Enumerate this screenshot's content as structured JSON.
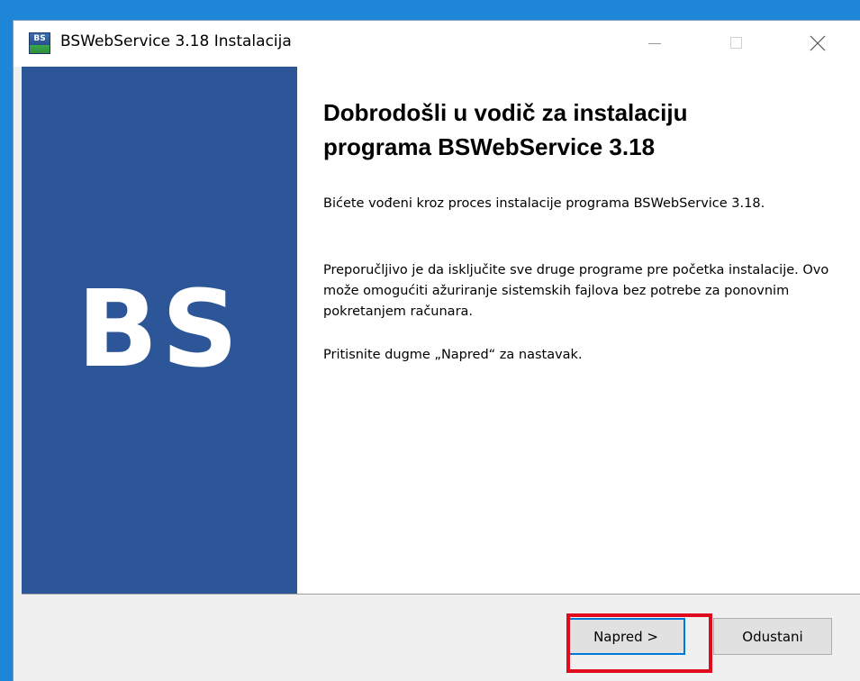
{
  "window": {
    "title": "BSWebService 3.18 Instalacija",
    "icon": "bs-app-icon",
    "icon_text": "BS"
  },
  "titlebar_controls": [
    "minimize",
    "maximize",
    "close"
  ],
  "sidebar": {
    "logo_text": "BS",
    "background": "#2d5699"
  },
  "main": {
    "heading": "Dobrodošli u vodič za instalaciju programa BSWebService 3.18",
    "intro": "Bićete vođeni kroz proces instalacije programa BSWebService 3.18.",
    "advice": "Preporučljivo je da isključite sve druge programe pre početka instalacije. Ovo može omogućiti ažuriranje sistemskih fajlova bez potrebe za ponovnim pokretanjem računara.",
    "continue_hint": "Pritisnite dugme „Napred“ za nastavak."
  },
  "buttons": {
    "next_label": "Napred >",
    "cancel_label": "Odustani"
  },
  "colors": {
    "desktop": "#1e86d6",
    "highlight": "#e00b1c",
    "focus": "#0078d7"
  }
}
